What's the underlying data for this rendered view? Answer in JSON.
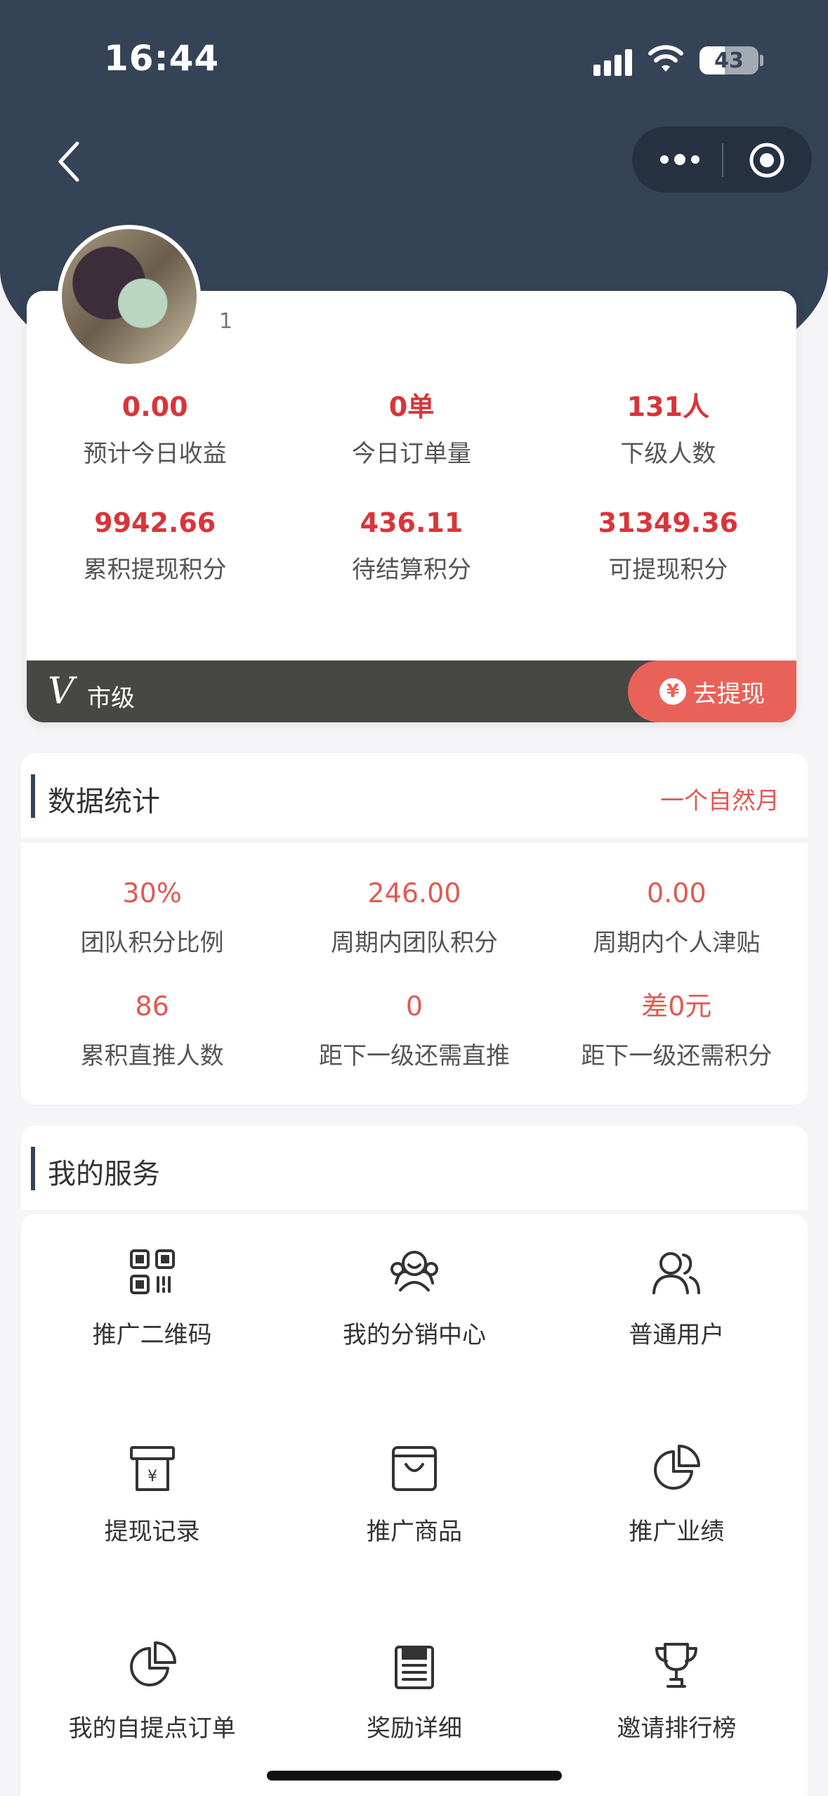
{
  "status_bar": {
    "time": "16:44",
    "battery": "43"
  },
  "header": {
    "capsule_more_icon": "more-dots-icon",
    "capsule_close_icon": "target-icon"
  },
  "profile": {
    "username": "1",
    "stats": [
      {
        "value": "0.00",
        "label": "预计今日收益"
      },
      {
        "value": "0单",
        "label": "今日订单量"
      },
      {
        "value": "131人",
        "label": "下级人数"
      },
      {
        "value": "9942.66",
        "label": "累积提现积分"
      },
      {
        "value": "436.11",
        "label": "待结算积分"
      },
      {
        "value": "31349.36",
        "label": "可提现积分"
      }
    ],
    "level_icon": "V",
    "level": "市级",
    "withdraw_label": "去提现"
  },
  "data_stats": {
    "title": "数据统计",
    "period": "一个自然月",
    "items": [
      {
        "value": "30%",
        "label": "团队积分比例"
      },
      {
        "value": "246.00",
        "label": "周期内团队积分"
      },
      {
        "value": "0.00",
        "label": "周期内个人津贴"
      },
      {
        "value": "86",
        "label": "累积直推人数"
      },
      {
        "value": "0",
        "label": "距下一级还需直推"
      },
      {
        "value": "差0元",
        "label": "距下一级还需积分"
      }
    ]
  },
  "services": {
    "title": "我的服务",
    "items": [
      {
        "label": "推广二维码",
        "icon": "qr-code-icon"
      },
      {
        "label": "我的分销中心",
        "icon": "team-icon"
      },
      {
        "label": "普通用户",
        "icon": "users-icon"
      },
      {
        "label": "提现记录",
        "icon": "withdraw-record-icon"
      },
      {
        "label": "推广商品",
        "icon": "shopping-bag-icon"
      },
      {
        "label": "推广业绩",
        "icon": "pie-chart-icon"
      },
      {
        "label": "我的自提点订单",
        "icon": "pie-chart-icon"
      },
      {
        "label": "奖励详细",
        "icon": "reward-icon"
      },
      {
        "label": "邀请排行榜",
        "icon": "trophy-icon"
      }
    ]
  },
  "colors": {
    "header_bg": "#354357",
    "accent_red": "#d8353a",
    "withdraw_button": "#e9625a"
  }
}
